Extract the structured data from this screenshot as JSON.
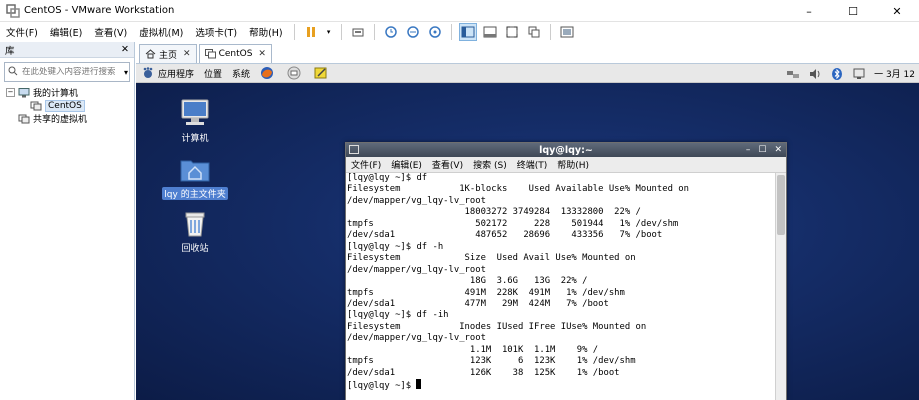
{
  "window": {
    "title": "CentOS - VMware Workstation",
    "minimize": "–",
    "maximize": "☐",
    "close": "✕"
  },
  "menu": {
    "items": [
      "文件(F)",
      "编辑(E)",
      "查看(V)",
      "虚拟机(M)",
      "选项卡(T)",
      "帮助(H)"
    ]
  },
  "library": {
    "title": "库",
    "close": "✕",
    "search_placeholder": "在此处键入内容进行搜索",
    "tree": {
      "root": "我的计算机",
      "root_expander": "−",
      "child": "CentOS",
      "shared": "共享的虚拟机"
    }
  },
  "tabs": [
    {
      "label": "主页",
      "close": "✕"
    },
    {
      "label": "CentOS",
      "close": "✕"
    }
  ],
  "guest_panel": {
    "applications": "应用程序",
    "places": "位置",
    "system": "系统",
    "clock": "一 3月 12"
  },
  "desktop": {
    "icons": [
      {
        "label": "计算机"
      },
      {
        "label": "lqy 的主文件夹"
      },
      {
        "label": "回收站"
      }
    ]
  },
  "terminal": {
    "title": "lqy@lqy:~",
    "menu": [
      "文件(F)",
      "编辑(E)",
      "查看(V)",
      "搜索 (S)",
      "终端(T)",
      "帮助(H)"
    ],
    "lines": [
      "[lqy@lqy ~]$ df",
      "Filesystem           1K-blocks    Used Available Use% Mounted on",
      "/dev/mapper/vg_lqy-lv_root",
      "                      18003272 3749284  13332800  22% /",
      "tmpfs                   502172     228    501944   1% /dev/shm",
      "/dev/sda1               487652   28696    433356   7% /boot",
      "[lqy@lqy ~]$ df -h",
      "Filesystem            Size  Used Avail Use% Mounted on",
      "/dev/mapper/vg_lqy-lv_root",
      "                       18G  3.6G   13G  22% /",
      "tmpfs                 491M  228K  491M   1% /dev/shm",
      "/dev/sda1             477M   29M  424M   7% /boot",
      "[lqy@lqy ~]$ df -ih",
      "Filesystem           Inodes IUsed IFree IUse% Mounted on",
      "/dev/mapper/vg_lqy-lv_root",
      "                       1.1M  101K  1.1M    9% /",
      "tmpfs                  123K     6  123K    1% /dev/shm",
      "/dev/sda1              126K    38  125K    1% /boot"
    ],
    "prompt": "[lqy@lqy ~]$ "
  },
  "colors": {
    "desktop_bg": "#152d68",
    "terminal_title_bg": "#4a5464",
    "selection": "#4f7fd0"
  }
}
